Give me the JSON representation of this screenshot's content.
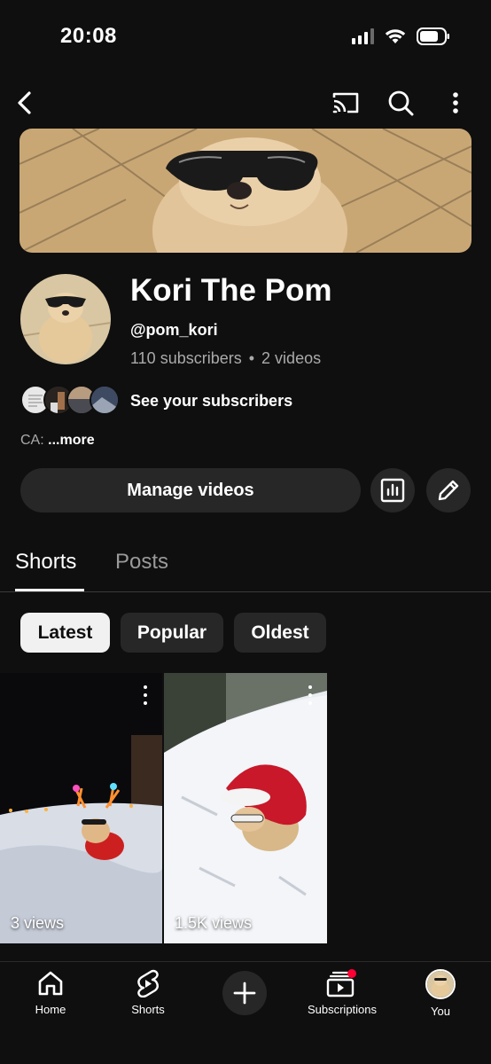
{
  "status": {
    "time": "20:08"
  },
  "channel": {
    "name": "Kori The Pom",
    "handle": "@pom_kori",
    "subscribers": "110 subscribers",
    "separator": "•",
    "videos": "2 videos",
    "subscribers_link": "See your subscribers",
    "description_prefix": "CA:",
    "description_more": "...more"
  },
  "actions": {
    "manage_videos": "Manage videos"
  },
  "tabs": [
    {
      "label": "Shorts",
      "active": true
    },
    {
      "label": "Posts",
      "active": false
    }
  ],
  "filters": [
    {
      "label": "Latest",
      "selected": true
    },
    {
      "label": "Popular",
      "selected": false
    },
    {
      "label": "Oldest",
      "selected": false
    }
  ],
  "shorts": [
    {
      "views": "3 views"
    },
    {
      "views": "1.5K views"
    }
  ],
  "bottom_nav": [
    {
      "label": "Home",
      "icon": "home-icon"
    },
    {
      "label": "Shorts",
      "icon": "shorts-icon"
    },
    {
      "label": "",
      "icon": "plus-icon"
    },
    {
      "label": "Subscriptions",
      "icon": "subscriptions-icon"
    },
    {
      "label": "You",
      "icon": "avatar"
    }
  ],
  "colors": {
    "background": "#0f0f0f",
    "surface": "#272727",
    "accent_red": "#ff0033",
    "muted_text": "#aaaaaa"
  }
}
